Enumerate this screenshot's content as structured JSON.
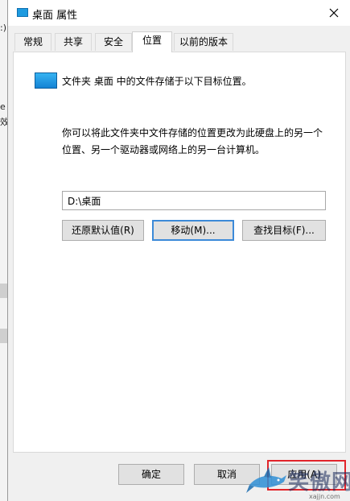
{
  "background_window": {
    "fragments": [
      ":)",
      "e",
      "效"
    ]
  },
  "window": {
    "title": "桌面 属性",
    "close_glyph": "✕"
  },
  "tabs": [
    {
      "label": "常规"
    },
    {
      "label": "共享"
    },
    {
      "label": "安全"
    },
    {
      "label": "位置",
      "active": true
    },
    {
      "label": "以前的版本"
    }
  ],
  "location": {
    "folder_line": "文件夹 桌面 中的文件存储于以下目标位置。",
    "description": "你可以将此文件夹中文件存储的位置更改为此硬盘上的另一个位置、另一个驱动器或网络上的另一台计算机。",
    "path_value": "D:\\桌面",
    "restore_default_label": "还原默认值(R)",
    "move_label": "移动(M)...",
    "find_target_label": "查找目标(F)..."
  },
  "footer": {
    "ok_label": "确定",
    "cancel_label": "取消",
    "apply_label": "应用(A)"
  },
  "watermark": {
    "text": "笑傲网",
    "url": "xajjn.com"
  },
  "colors": {
    "folder_blue": "#1e9be0",
    "highlight_red": "#e2242a",
    "focus_blue": "#3c8ad8"
  }
}
